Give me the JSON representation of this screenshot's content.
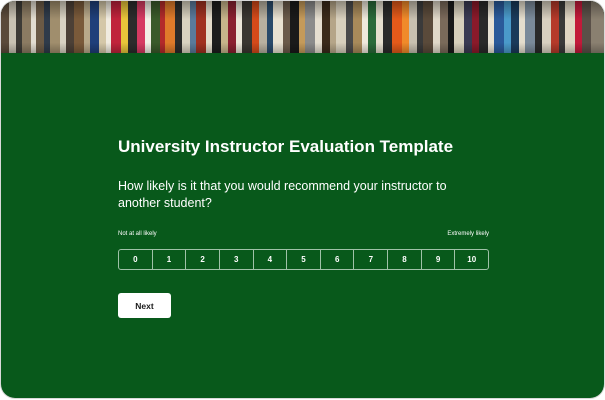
{
  "survey": {
    "title": "University Instructor Evaluation Template",
    "question": "How likely is it that you would recommend your instructor to another student?",
    "scale": {
      "low_label": "Not at all likely",
      "high_label": "Extremely likely",
      "options": [
        "0",
        "1",
        "2",
        "3",
        "4",
        "5",
        "6",
        "7",
        "8",
        "9",
        "10"
      ]
    },
    "next_label": "Next"
  },
  "colors": {
    "background": "#08591b",
    "text": "#ffffff",
    "scale_border": "#9fc2a8",
    "button": "#ffffff"
  },
  "banner": {
    "image": "bookshelf-photo"
  }
}
